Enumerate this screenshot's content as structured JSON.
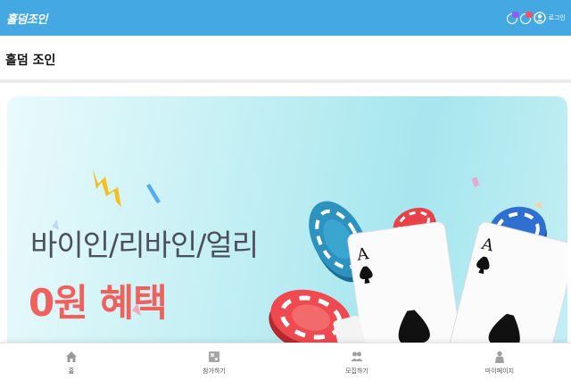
{
  "header": {
    "logo_text": "홀덤조인",
    "login_label": "로그인",
    "icons": [
      "chat-badge-icon",
      "alert-badge-icon",
      "user-icon"
    ],
    "colors": {
      "bar": "#44a9e3",
      "badge_purple": "#8e5cf0",
      "badge_red": "#f0506e"
    }
  },
  "page": {
    "title": "홀덤 조인"
  },
  "banner": {
    "line1": "바이인/리바인/얼리",
    "line2": "0원 혜택",
    "colors": {
      "line1": "#4b4f5a",
      "line2": "#f0605c"
    }
  },
  "tabs": [
    {
      "label": "홈",
      "icon": "home-icon"
    },
    {
      "label": "참가하기",
      "icon": "join-icon"
    },
    {
      "label": "모집하기",
      "icon": "recruit-icon"
    },
    {
      "label": "마이페이지",
      "icon": "mypage-icon"
    }
  ]
}
